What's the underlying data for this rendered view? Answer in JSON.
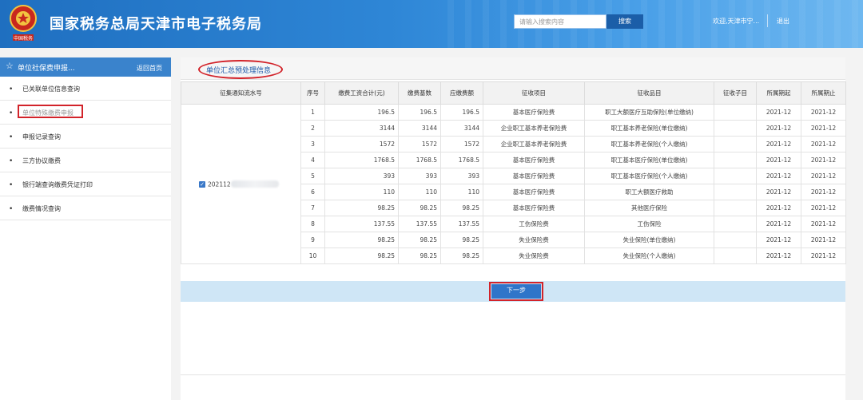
{
  "header": {
    "title": "国家税务总局天津市电子税务局",
    "search_placeholder": "请输入搜索内容",
    "search_button": "搜索",
    "welcome": "欢迎,天津市宁...",
    "logout": "退出"
  },
  "sidebar": {
    "title": "单位社保费申报...",
    "back_label": "返回首页",
    "items": [
      {
        "label": "已关联单位信息查询"
      },
      {
        "label": "单位特殊缴费申报"
      },
      {
        "label": "申报记录查询"
      },
      {
        "label": "三方协议缴费"
      },
      {
        "label": "银行端查询缴费凭证打印"
      },
      {
        "label": "缴费情况查询"
      }
    ]
  },
  "panel": {
    "title": "单位汇总预处理信息",
    "columns": [
      "征集通知流水号",
      "序号",
      "缴费工资合计(元)",
      "缴费基数",
      "应缴费额",
      "征收项目",
      "征收品目",
      "征收子目",
      "所属期起",
      "所属期止"
    ],
    "serial_number": "202112",
    "rows": [
      {
        "no": "1",
        "wage": "196.5",
        "base": "196.5",
        "due": "196.5",
        "item": "基本医疗保险费",
        "category": "职工大额医疗互助保险(单位缴纳)",
        "sub": "",
        "start": "2021-12",
        "end": "2021-12"
      },
      {
        "no": "2",
        "wage": "3144",
        "base": "3144",
        "due": "3144",
        "item": "企业职工基本养老保险费",
        "category": "职工基本养老保险(单位缴纳)",
        "sub": "",
        "start": "2021-12",
        "end": "2021-12"
      },
      {
        "no": "3",
        "wage": "1572",
        "base": "1572",
        "due": "1572",
        "item": "企业职工基本养老保险费",
        "category": "职工基本养老保险(个人缴纳)",
        "sub": "",
        "start": "2021-12",
        "end": "2021-12"
      },
      {
        "no": "4",
        "wage": "1768.5",
        "base": "1768.5",
        "due": "1768.5",
        "item": "基本医疗保险费",
        "category": "职工基本医疗保险(单位缴纳)",
        "sub": "",
        "start": "2021-12",
        "end": "2021-12"
      },
      {
        "no": "5",
        "wage": "393",
        "base": "393",
        "due": "393",
        "item": "基本医疗保险费",
        "category": "职工基本医疗保险(个人缴纳)",
        "sub": "",
        "start": "2021-12",
        "end": "2021-12"
      },
      {
        "no": "6",
        "wage": "110",
        "base": "110",
        "due": "110",
        "item": "基本医疗保险费",
        "category": "职工大额医疗救助",
        "sub": "",
        "start": "2021-12",
        "end": "2021-12"
      },
      {
        "no": "7",
        "wage": "98.25",
        "base": "98.25",
        "due": "98.25",
        "item": "基本医疗保险费",
        "category": "其他医疗保险",
        "sub": "",
        "start": "2021-12",
        "end": "2021-12"
      },
      {
        "no": "8",
        "wage": "137.55",
        "base": "137.55",
        "due": "137.55",
        "item": "工伤保险费",
        "category": "工伤保险",
        "sub": "",
        "start": "2021-12",
        "end": "2021-12"
      },
      {
        "no": "9",
        "wage": "98.25",
        "base": "98.25",
        "due": "98.25",
        "item": "失业保险费",
        "category": "失业保险(单位缴纳)",
        "sub": "",
        "start": "2021-12",
        "end": "2021-12"
      },
      {
        "no": "10",
        "wage": "98.25",
        "base": "98.25",
        "due": "98.25",
        "item": "失业保险费",
        "category": "失业保险(个人缴纳)",
        "sub": "",
        "start": "2021-12",
        "end": "2021-12"
      }
    ],
    "next_button": "下一步"
  },
  "colors": {
    "header_blue": "#2e86d6",
    "sidebar_head": "#3a83cc",
    "highlight_red": "#d2232a",
    "action_bar": "#cfe6f6",
    "button_blue": "#2f75c9"
  }
}
